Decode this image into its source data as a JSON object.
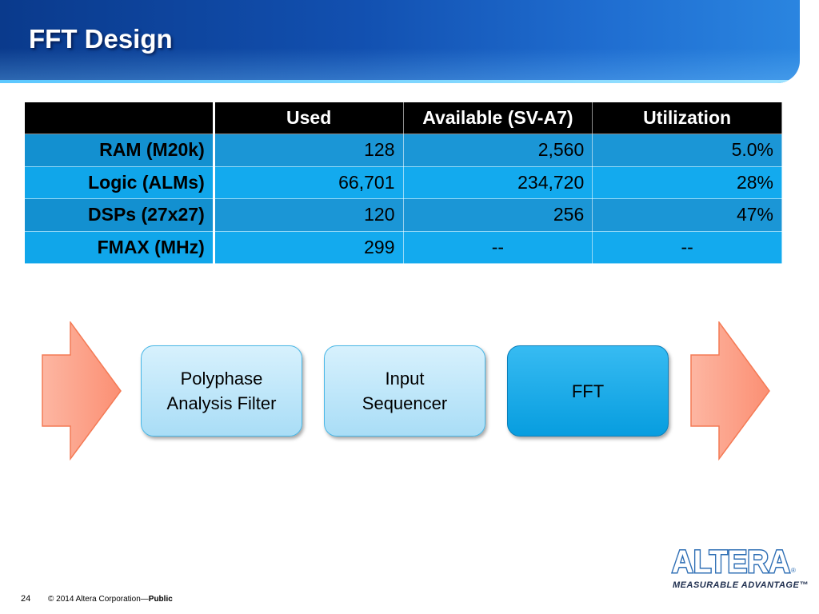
{
  "slide": {
    "title": "FFT Design",
    "page_number": "24",
    "copyright": "© 2014 Altera Corporation—",
    "classification": "Public"
  },
  "table": {
    "headers": [
      "",
      "Used",
      "Available (SV-A7)",
      "Utilization"
    ],
    "rows": [
      {
        "label": "RAM (M20k)",
        "used": "128",
        "available": "2,560",
        "utilization": "5.0%"
      },
      {
        "label": "Logic (ALMs)",
        "used": "66,701",
        "available": "234,720",
        "utilization": "28%"
      },
      {
        "label": "DSPs (27x27)",
        "used": "120",
        "available": "256",
        "utilization": "47%"
      },
      {
        "label": "FMAX (MHz)",
        "used": "299",
        "available": "--",
        "utilization": "--"
      }
    ]
  },
  "flow": {
    "blocks": [
      {
        "label": "Polyphase\nAnalysis Filter",
        "style": "light"
      },
      {
        "label": "Input\nSequencer",
        "style": "light"
      },
      {
        "label": "FFT",
        "style": "dark"
      }
    ],
    "arrow_color": "#fc9a80"
  },
  "logo": {
    "brand": "ALTERA",
    "tagline": "MEASURABLE ADVANTAGE™",
    "color": "#2f6fb5"
  },
  "colors": {
    "header_blue": "#1250b0",
    "table_header": "#000000",
    "row_odd": "#1b96d6",
    "row_even": "#13aaee"
  }
}
